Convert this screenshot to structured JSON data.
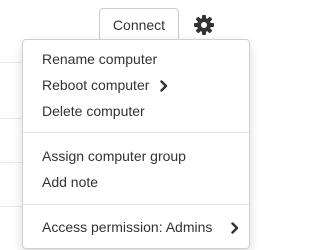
{
  "toolbar": {
    "connect_label": "Connect",
    "settings_icon": "gear-icon"
  },
  "menu": {
    "items": [
      {
        "label": "Rename computer"
      },
      {
        "label": "Reboot computer",
        "submenu_icon": "chevron-right-icon"
      },
      {
        "label": "Delete computer"
      },
      {
        "label": "Assign computer group"
      },
      {
        "label": "Add note"
      },
      {
        "label": "Access permission: Admins",
        "submenu_icon": "chevron-right-icon"
      }
    ]
  }
}
